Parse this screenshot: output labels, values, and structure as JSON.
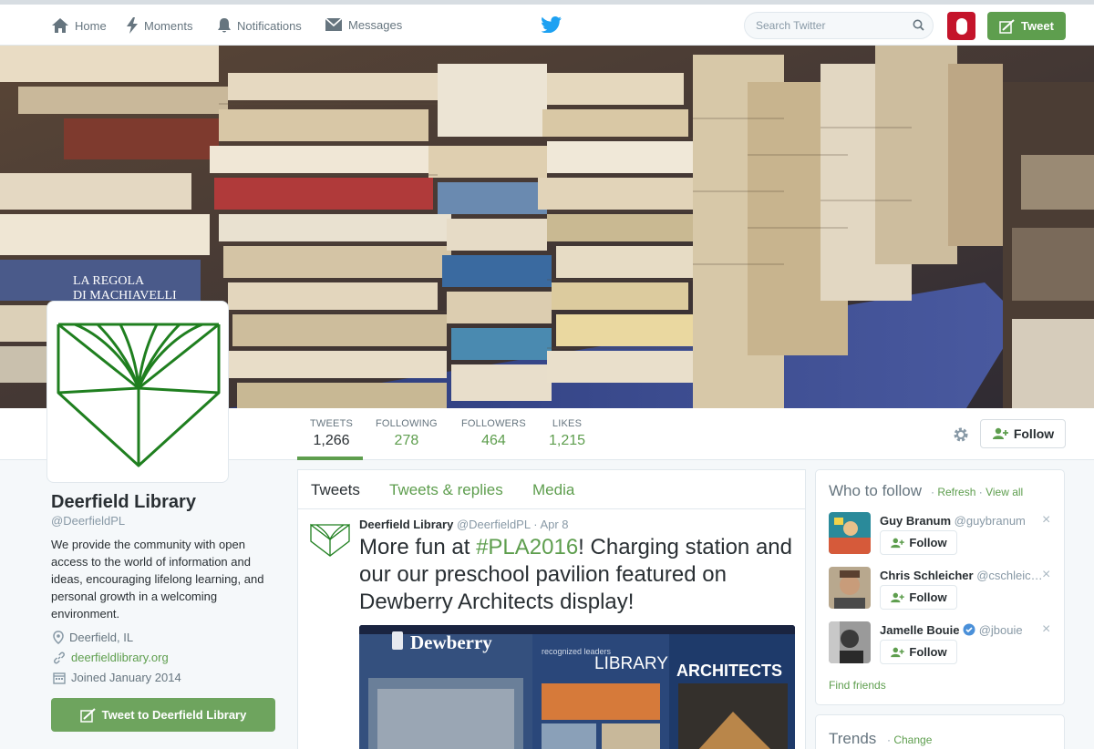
{
  "nav": {
    "home": "Home",
    "moments": "Moments",
    "notifications": "Notifications",
    "messages": "Messages",
    "search_placeholder": "Search Twitter",
    "tweet_button": "Tweet"
  },
  "profile": {
    "name": "Deerfield Library",
    "handle": "@DeerfieldPL",
    "bio": "We provide the community with open access to the world of information and ideas, encouraging lifelong learning, and personal growth in a welcoming environment.",
    "location": "Deerfield, IL",
    "website": "deerfieldlibrary.org",
    "joined": "Joined January 2014",
    "tweet_to_button": "Tweet to Deerfield Library"
  },
  "stats": [
    {
      "label": "TWEETS",
      "value": "1,266"
    },
    {
      "label": "FOLLOWING",
      "value": "278"
    },
    {
      "label": "FOLLOWERS",
      "value": "464"
    },
    {
      "label": "LIKES",
      "value": "1,215"
    }
  ],
  "follow_button": "Follow",
  "timeline": {
    "tabs": [
      "Tweets",
      "Tweets & replies",
      "Media"
    ],
    "tweet": {
      "name": "Deerfield Library",
      "handle": "@DeerfieldPL",
      "sep": "·",
      "date": "Apr 8",
      "text_before": "More fun at ",
      "hashtag": "#PLA2016",
      "text_after": "! Charging station and our our preschool pavilion featured on Dewberry Architects display!",
      "media_text_1": "Dewberry",
      "media_text_2": "recognized leaders",
      "media_text_3": "LIBRARY",
      "media_text_4": "ARCHITECTS"
    }
  },
  "who_to_follow": {
    "title": "Who to follow",
    "sep1": "·",
    "refresh": "Refresh",
    "sep2": "·",
    "view_all": "View all",
    "suggestions": [
      {
        "name": "Guy Branum",
        "handle": "@guybranum",
        "follow": "Follow"
      },
      {
        "name": "Chris Schleicher",
        "handle": "@cschleic…",
        "follow": "Follow"
      },
      {
        "name": "Jamelle Bouie",
        "handle": "@jbouie",
        "follow": "Follow"
      }
    ],
    "close": "×",
    "find_friends": "Find friends"
  },
  "trends": {
    "title": "Trends",
    "sep": "·",
    "change": "Change"
  },
  "colors": {
    "accent": "#5e9e4e",
    "nav_bg": "#ffffff",
    "page_bg": "#f5f8fa"
  }
}
